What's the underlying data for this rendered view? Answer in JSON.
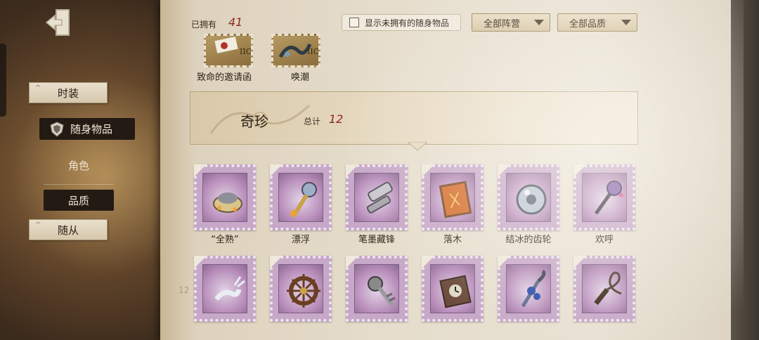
{
  "left_nav": {
    "items": [
      {
        "label": "时装",
        "style": "paper"
      },
      {
        "label": "随身物品",
        "style": "dark",
        "icon": "shield-icon",
        "selected": true
      },
      {
        "label": "角色",
        "style": "plain"
      },
      {
        "label": "品质",
        "style": "dark"
      },
      {
        "label": "随从",
        "style": "paper"
      }
    ]
  },
  "header": {
    "owned_label": "已拥有",
    "owned_count": "41",
    "show_unowned_label": "显示未拥有的随身物品",
    "show_unowned_checked": false,
    "camp_filter": "全部阵营",
    "quality_filter": "全部品质"
  },
  "top_row_items": [
    {
      "label": "致命的邀请函",
      "icon": "envelope-stamp-icon"
    },
    {
      "label": "唤潮",
      "icon": "tide-stamp-icon"
    }
  ],
  "section": {
    "title": "奇珍",
    "total_label": "总计",
    "total": "12"
  },
  "items": [
    {
      "label": "“全熟”",
      "icon": "pot-icon"
    },
    {
      "label": "漂浮",
      "icon": "lantern-icon"
    },
    {
      "label": "笔墨藏锋",
      "icon": "scroll-icon"
    },
    {
      "label": "落木",
      "icon": "autumn-frame-icon"
    },
    {
      "label": "结冰的齿轮",
      "icon": "frozen-gear-icon"
    },
    {
      "label": "欢呼",
      "icon": "scepter-icon"
    },
    {
      "label": "",
      "icon": "deer-icon"
    },
    {
      "label": "",
      "icon": "ship-wheel-icon"
    },
    {
      "label": "",
      "icon": "spiked-key-icon"
    },
    {
      "label": "",
      "icon": "clock-frame-icon"
    },
    {
      "label": "",
      "icon": "rose-cane-icon"
    },
    {
      "label": "",
      "icon": "whip-icon"
    }
  ],
  "page_number": "12",
  "colors": {
    "accent_red": "#8a2a1e",
    "stamp_purple": "#c7a8c8",
    "paper": "#e6ddcc"
  }
}
